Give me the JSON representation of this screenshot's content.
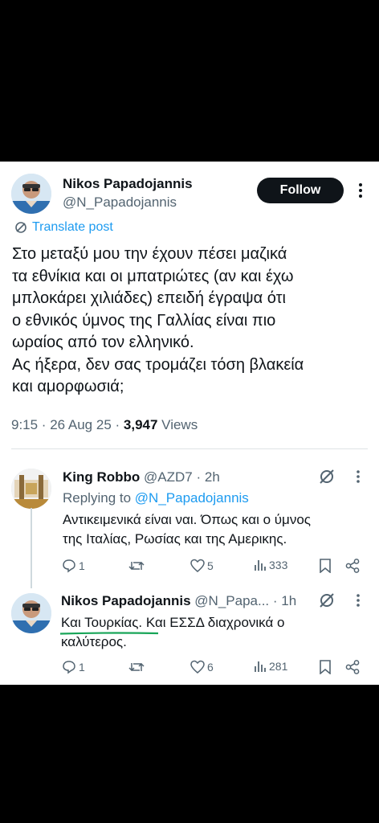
{
  "main_tweet": {
    "author_name": "Nikos Papadojannis",
    "author_handle": "@N_Papadojannis",
    "follow_label": "Follow",
    "translate_label": "Translate post",
    "text_lines": [
      "Στο μεταξύ μου την έχουν πέσει μαζικά",
      "τα εθνίκια και οι μπατριώτες (αν και έχω",
      "μπλοκάρει χιλιάδες) επειδή έγραψα ότι",
      "ο εθνικός ύμνος της Γαλλίας είναι πιο",
      "ωραίος από τον ελληνικό.",
      "Ας ήξερα, δεν σας τρομάζει τόση βλακεία",
      "και αμορφωσιά;"
    ],
    "timestamp": "9:15 · 26 Aug 25 · ",
    "views_count": "3,947",
    "views_label": " Views"
  },
  "replies": [
    {
      "author_name": "King Robbo",
      "author_handle_time": "@AZD7 · 2h",
      "replying_prefix": "Replying to ",
      "replying_mention": "@N_Papadojannis",
      "text_lines": [
        "Αντικειμενικά είναι ναι. Όπως και ο ύμνος",
        "της Ιταλίας, Ρωσίας και της Αμερικης."
      ],
      "actions": {
        "replies": "1",
        "reposts": "",
        "likes": "5",
        "views": "333"
      }
    },
    {
      "author_name": "Nikos Papadojannis",
      "author_handle_time": "@N_Papa... · 1h",
      "text_lines": [
        "Και Τουρκίας. Και ΕΣΣΔ διαχρονικά ο",
        "καλύτερος."
      ],
      "actions": {
        "replies": "1",
        "reposts": "",
        "likes": "6",
        "views": "281"
      }
    }
  ],
  "colors": {
    "accent": "#1d9bf0",
    "text_primary": "#0f1419",
    "text_secondary": "#536471",
    "underline": "#18a558",
    "background": "#ffffff",
    "letterbox": "#000000"
  },
  "icons": [
    "translate-icon",
    "more-icon",
    "grok-icon",
    "reply-icon",
    "repost-icon",
    "like-icon",
    "views-icon",
    "bookmark-icon",
    "share-icon"
  ]
}
